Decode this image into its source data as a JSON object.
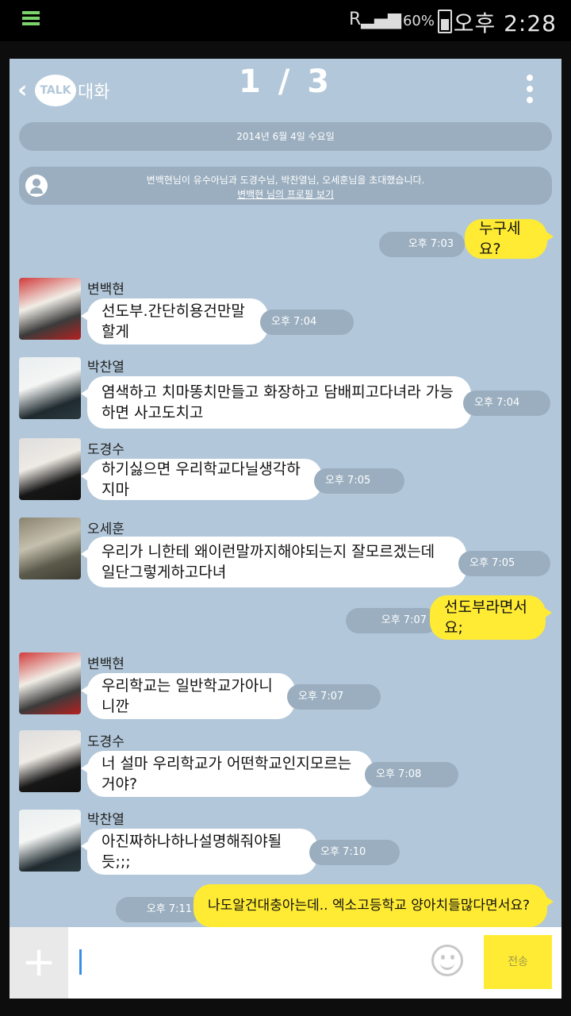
{
  "status_bar": {
    "signal_label": "R",
    "battery": "60%",
    "time": "오후 2:28"
  },
  "header": {
    "app_badge": "TALK",
    "back_label": "대화",
    "page": "1 / 3"
  },
  "system": {
    "date": "2014년 6월 4일 수요일",
    "invite_text": "변백현님이 유수아님과 도경수님, 박찬열님, 오세훈님을 초대했습니다.",
    "invite_link": "변백현 님의 프로필 보기"
  },
  "messages": [
    {
      "sender": "me",
      "text": "누구세요?",
      "time": "오후 7:03"
    },
    {
      "sender": "변백현",
      "text": "선도부.간단히용건만말할게",
      "time": "오후 7:04"
    },
    {
      "sender": "박찬열",
      "text": "염색하고 치마똥치만들고 화장하고 담배피고다녀라 가능하면 사고도치고",
      "time": "오후 7:04"
    },
    {
      "sender": "도경수",
      "text": "하기싫으면 우리학교다닐생각하지마",
      "time": "오후 7:05"
    },
    {
      "sender": "오세훈",
      "text": "우리가 니한테 왜이런말까지해야되는지 잘모르겠는데 일단그렇게하고다녀",
      "time": "오후 7:05"
    },
    {
      "sender": "me",
      "text": "선도부라면서요;",
      "time": "오후 7:07"
    },
    {
      "sender": "변백현",
      "text": "우리학교는 일반학교가아니니깐",
      "time": "오후 7:07"
    },
    {
      "sender": "도경수",
      "text": "너 설마 우리학교가 어떤학교인지모르는거야?",
      "time": "오후 7:08"
    },
    {
      "sender": "박찬열",
      "text": "아진짜하나하나설명해줘야될듯;;;",
      "time": "오후 7:10"
    },
    {
      "sender": "me",
      "text": "나도알건대충아는데.. 엑소고등학교 양아치들많다면서요?",
      "time": "오후 7:11"
    }
  ],
  "input": {
    "send_label": "전송",
    "plus_icon": "plus-icon",
    "emoji_icon": "smiley-icon"
  },
  "colors": {
    "chat_bg": "#b2c7d9",
    "my_bubble": "#ffeb33",
    "their_bubble": "#ffffff",
    "pill": "#9aaebf"
  }
}
